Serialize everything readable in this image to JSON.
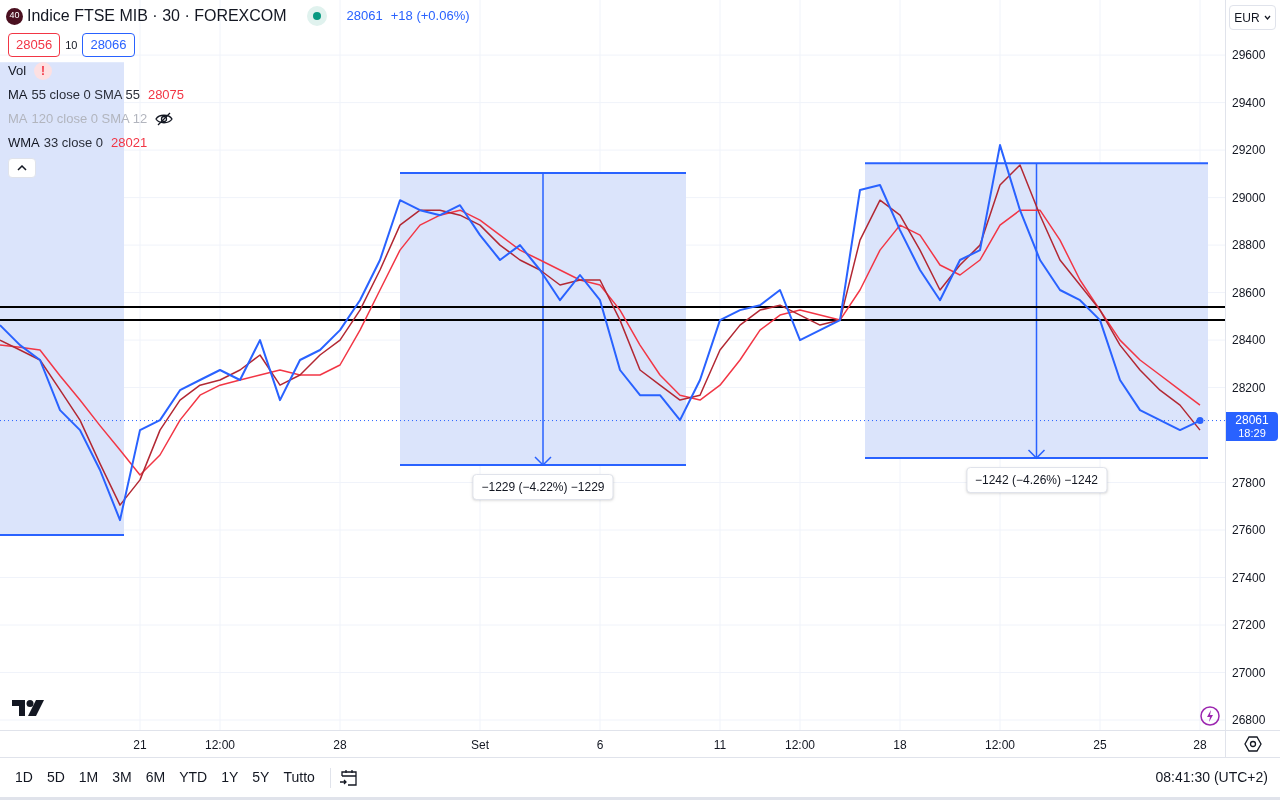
{
  "header": {
    "badge": "40",
    "title": "Indice FTSE MIB · 30 · FOREXCOM",
    "market_open": true,
    "price": "28061",
    "change": "+18 (+0.06%)"
  },
  "quote": {
    "bid": "28056",
    "spread": "10",
    "ask": "28066"
  },
  "indicators": [
    {
      "kind": "vol",
      "name": "Vol",
      "alert": "!"
    },
    {
      "kind": "ma",
      "name": "MA",
      "params": "55 close 0 SMA 55",
      "value": "28075",
      "hidden": false
    },
    {
      "kind": "ma",
      "name": "MA",
      "params": "120 close 0 SMA 12",
      "hidden": true
    },
    {
      "kind": "ma",
      "name": "WMA",
      "params": "33 close 0",
      "value": "28021",
      "hidden": false
    }
  ],
  "legend_collapsed": false,
  "currency": "EUR",
  "last_price_tag": {
    "price": "28061",
    "countdown": "18:29"
  },
  "chart_data": {
    "type": "line",
    "categories": [
      null,
      null,
      null,
      null,
      null,
      null,
      null,
      "21",
      null,
      null,
      null,
      "12:00",
      null,
      null,
      null,
      null,
      null,
      "28",
      null,
      null,
      null,
      null,
      null,
      null,
      "Set",
      null,
      null,
      null,
      null,
      null,
      "6",
      null,
      null,
      null,
      null,
      null,
      "11",
      null,
      null,
      null,
      "12:00",
      null,
      null,
      null,
      null,
      "18",
      null,
      null,
      null,
      null,
      "12:00",
      null,
      null,
      null,
      null,
      "25",
      null,
      null,
      null,
      null,
      "28"
    ],
    "ylim": [
      26758,
      29832
    ],
    "yticks": [
      26800,
      27000,
      27200,
      27400,
      27600,
      27800,
      28200,
      28400,
      28600,
      28800,
      29000,
      29200,
      29400,
      29600
    ],
    "series": [
      {
        "color": "#2962ff",
        "values": [
          28463,
          28379,
          28316,
          28105,
          28021,
          27853,
          27642,
          28021,
          28063,
          28189,
          28232,
          28274,
          28232,
          28400,
          28147,
          28316,
          28358,
          28442,
          28568,
          28737,
          28989,
          28947,
          28926,
          28968,
          28842,
          28737,
          28800,
          28695,
          28568,
          28674,
          28568,
          28274,
          28168,
          28168,
          28063,
          28232,
          28484,
          28526,
          28547,
          28611,
          28400,
          28442,
          28484,
          29032,
          29053,
          28863,
          28695,
          28568,
          28737,
          28779,
          29221,
          28947,
          28737,
          28611,
          28568,
          28484,
          28232,
          28105,
          28063,
          28021,
          28061
        ]
      },
      {
        "color": "#b22833",
        "values": [
          28400,
          28358,
          28316,
          28190,
          28063,
          27880,
          27705,
          27811,
          28021,
          28147,
          28210,
          28232,
          28274,
          28337,
          28210,
          28253,
          28337,
          28400,
          28526,
          28695,
          28884,
          28947,
          28947,
          28926,
          28884,
          28800,
          28737,
          28695,
          28632,
          28653,
          28653,
          28484,
          28274,
          28210,
          28147,
          28168,
          28358,
          28463,
          28526,
          28547,
          28505,
          28463,
          28484,
          28821,
          28989,
          28926,
          28779,
          28611,
          28716,
          28800,
          29053,
          29137,
          28926,
          28737,
          28632,
          28526,
          28379,
          28274,
          28189,
          28126,
          28021
        ]
      },
      {
        "color": "#f23645",
        "values": [
          28379,
          28370,
          28358,
          28250,
          28147,
          28040,
          27937,
          27832,
          27916,
          28063,
          28168,
          28210,
          28232,
          28253,
          28274,
          28253,
          28253,
          28295,
          28442,
          28611,
          28779,
          28884,
          28926,
          28947,
          28905,
          28842,
          28779,
          28737,
          28695,
          28653,
          28632,
          28526,
          28379,
          28253,
          28168,
          28147,
          28210,
          28316,
          28442,
          28505,
          28526,
          28505,
          28484,
          28611,
          28779,
          28884,
          28842,
          28716,
          28674,
          28737,
          28884,
          28947,
          28947,
          28821,
          28653,
          28526,
          28400,
          28316,
          28253,
          28189,
          28126
        ]
      }
    ],
    "grid": true,
    "ref_lines": [
      {
        "axis": "y",
        "value": 28539,
        "color": "#000000"
      },
      {
        "axis": "y",
        "value": 28484,
        "color": "#000000"
      },
      {
        "axis": "y",
        "value": 28061,
        "color": "#2962ff"
      }
    ]
  },
  "measure_labels": [
    "−1229 (−4.22%) −1229",
    "−1242 (−4.26%) −1242"
  ],
  "ranges": [
    "1D",
    "5D",
    "1M",
    "3M",
    "6M",
    "YTD",
    "1Y",
    "5Y",
    "Tutto"
  ],
  "clock": "08:41:30 (UTC+2)"
}
